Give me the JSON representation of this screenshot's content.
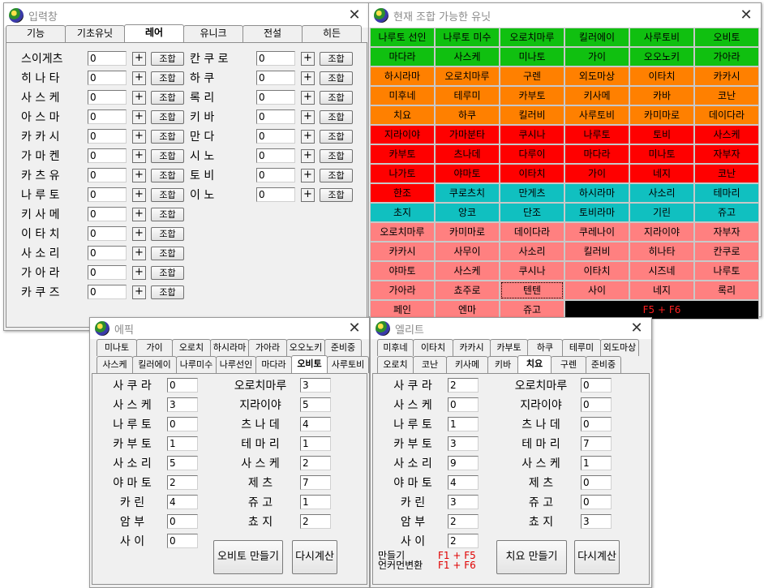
{
  "input_window": {
    "title": "입력창",
    "tabs": [
      "기능",
      "기초유닛",
      "레어",
      "유니크",
      "전설",
      "히든"
    ],
    "active_tab": 2,
    "button_plus": "+",
    "button_combine": "조합",
    "left_units": [
      {
        "name": "스이게츠",
        "value": "0"
      },
      {
        "name": "히 나 타",
        "value": "0"
      },
      {
        "name": "사 스 케",
        "value": "0"
      },
      {
        "name": "아 스 마",
        "value": "0"
      },
      {
        "name": "카 카 시",
        "value": "0"
      },
      {
        "name": "가 마 켄",
        "value": "0"
      },
      {
        "name": "카 츠 유",
        "value": "0"
      },
      {
        "name": "나 루 토",
        "value": "0"
      },
      {
        "name": "키 사 메",
        "value": "0"
      },
      {
        "name": "이 타 치",
        "value": "0"
      },
      {
        "name": "사 소 리",
        "value": "0"
      },
      {
        "name": "가 아 라",
        "value": "0"
      },
      {
        "name": "카 쿠 즈",
        "value": "0"
      }
    ],
    "right_units": [
      {
        "name": "칸 쿠 로",
        "value": "0"
      },
      {
        "name": "하    쿠",
        "value": "0"
      },
      {
        "name": "록    리",
        "value": "0"
      },
      {
        "name": "키    바",
        "value": "0"
      },
      {
        "name": "만    다",
        "value": "0"
      },
      {
        "name": "시    노",
        "value": "0"
      },
      {
        "name": "토    비",
        "value": "0"
      },
      {
        "name": "이    노",
        "value": "0"
      }
    ]
  },
  "combo_window": {
    "title": "현재 조합 가능한 유닛",
    "colors": {
      "green": "#10c010",
      "orange": "#ff8000",
      "red": "#ff0000",
      "cyan": "#10c0c0",
      "pink": "#ff8080",
      "black": "#000000",
      "footer_text": "#ff2020"
    },
    "rows": [
      {
        "color": "green",
        "cells": [
          "나루토 선인",
          "나루토 미수",
          "오로치마루",
          "킬러에이",
          "사루토비",
          "오비토"
        ]
      },
      {
        "color": "green",
        "cells": [
          "마다라",
          "사스케",
          "미나토",
          "가이",
          "오오노키",
          "가아라"
        ]
      },
      {
        "color": "orange",
        "cells": [
          "하시라마",
          "오로치마루",
          "구렌",
          "외도마상",
          "이타치",
          "카카시"
        ]
      },
      {
        "color": "orange",
        "cells": [
          "미후네",
          "테루미",
          "카부토",
          "키사메",
          "카바",
          "코난"
        ]
      },
      {
        "color": "orange",
        "cells": [
          "치요",
          "하쿠",
          "킬러비",
          "사루토비",
          "카미마로",
          "데이다라"
        ]
      },
      {
        "color": "red",
        "cells": [
          "지라이야",
          "가마분타",
          "쿠시나",
          "나루토",
          "토비",
          "사스케"
        ]
      },
      {
        "color": "red",
        "cells": [
          "카부토",
          "츠나데",
          "다루이",
          "마다라",
          "미나토",
          "자부자"
        ]
      },
      {
        "color": "red",
        "cells": [
          "나가토",
          "야마토",
          "이타치",
          "가이",
          "네지",
          "코난"
        ]
      },
      {
        "color": "mixed",
        "colors": [
          "red",
          "cyan",
          "cyan",
          "cyan",
          "cyan",
          "cyan"
        ],
        "cells": [
          "한조",
          "쿠로츠치",
          "만게츠",
          "하시라마",
          "사소리",
          "테마리"
        ]
      },
      {
        "color": "cyan",
        "cells": [
          "초지",
          "앙코",
          "단조",
          "토비라마",
          "기린",
          "쥬고"
        ]
      },
      {
        "color": "pink",
        "cells": [
          "오로치마루",
          "카미마로",
          "데이다라",
          "쿠레나이",
          "지라이야",
          "자부자"
        ]
      },
      {
        "color": "pink",
        "cells": [
          "카카시",
          "사무이",
          "사소리",
          "킬러비",
          "히나타",
          "칸쿠로"
        ]
      },
      {
        "color": "pink",
        "cells": [
          "야마토",
          "사스케",
          "쿠시나",
          "이타치",
          "시즈네",
          "나루토"
        ]
      },
      {
        "color": "pink",
        "cells": [
          "가아라",
          "쵸주로",
          "텐텐",
          "사이",
          "네지",
          "록리"
        ]
      },
      {
        "color": "pink",
        "cells": [
          "페인",
          "엔마",
          "쥬고"
        ]
      }
    ],
    "selected_cell": "텐텐",
    "footer_label": "F5 + F6"
  },
  "epic_window": {
    "title": "에픽",
    "tabs_row1": [
      "미나토",
      "가이",
      "오로치",
      "하시라마",
      "가아라",
      "오오노키",
      "준비중"
    ],
    "tabs_row2": [
      "사스케",
      "킬러에이",
      "나루미수",
      "나루선인",
      "마다라",
      "오비토",
      "사루토비"
    ],
    "active_tab": "오비토",
    "left": [
      {
        "name": "사 쿠 라",
        "value": "0"
      },
      {
        "name": "사 스 케",
        "value": "3"
      },
      {
        "name": "나 루 토",
        "value": "0"
      },
      {
        "name": "카 부 토",
        "value": "1"
      },
      {
        "name": "사 소 리",
        "value": "5"
      },
      {
        "name": "야 마 토",
        "value": "2"
      },
      {
        "name": "카    린",
        "value": "4"
      },
      {
        "name": "암    부",
        "value": "0"
      },
      {
        "name": "사    이",
        "value": "0"
      }
    ],
    "right": [
      {
        "name": "오로치마루",
        "value": "3"
      },
      {
        "name": "지라이야",
        "value": "5"
      },
      {
        "name": "츠 나 데",
        "value": "4"
      },
      {
        "name": "테 마 리",
        "value": "1"
      },
      {
        "name": "사 스 케",
        "value": "2"
      },
      {
        "name": "제    츠",
        "value": "7"
      },
      {
        "name": "쥬    고",
        "value": "1"
      },
      {
        "name": "쵸    지",
        "value": "2"
      }
    ],
    "make_button": "오비토 만들기",
    "recalc_button": "다시계산"
  },
  "elite_window": {
    "title": "엘리트",
    "tabs_row1": [
      "미후네",
      "이타치",
      "카카시",
      "카부토",
      "하쿠",
      "테루미",
      "외도마상"
    ],
    "tabs_row2": [
      "오로치",
      "코난",
      "키사메",
      "키바",
      "치요",
      "구렌",
      "준비중"
    ],
    "active_tab": "치요",
    "left": [
      {
        "name": "사 쿠 라",
        "value": "2"
      },
      {
        "name": "사 스 케",
        "value": "0"
      },
      {
        "name": "나 루 토",
        "value": "1"
      },
      {
        "name": "카 부 토",
        "value": "3"
      },
      {
        "name": "사 소 리",
        "value": "9"
      },
      {
        "name": "야 마 토",
        "value": "4"
      },
      {
        "name": "카    린",
        "value": "3"
      },
      {
        "name": "암    부",
        "value": "2"
      },
      {
        "name": "사    이",
        "value": "2"
      }
    ],
    "right": [
      {
        "name": "오로치마루",
        "value": "0"
      },
      {
        "name": "지라이야",
        "value": "0"
      },
      {
        "name": "츠 나 데",
        "value": "0"
      },
      {
        "name": "테 마 리",
        "value": "7"
      },
      {
        "name": "사 스 케",
        "value": "1"
      },
      {
        "name": "제    츠",
        "value": "0"
      },
      {
        "name": "쥬    고",
        "value": "0"
      },
      {
        "name": "쵸    지",
        "value": "3"
      }
    ],
    "hint_make_label": "만들기",
    "hint_make_keys": "F1 + F5",
    "hint_cursor_label": "언커먼변환",
    "hint_cursor_keys": "F1 + F6",
    "make_button": "치요 만들기",
    "recalc_button": "다시계산"
  }
}
